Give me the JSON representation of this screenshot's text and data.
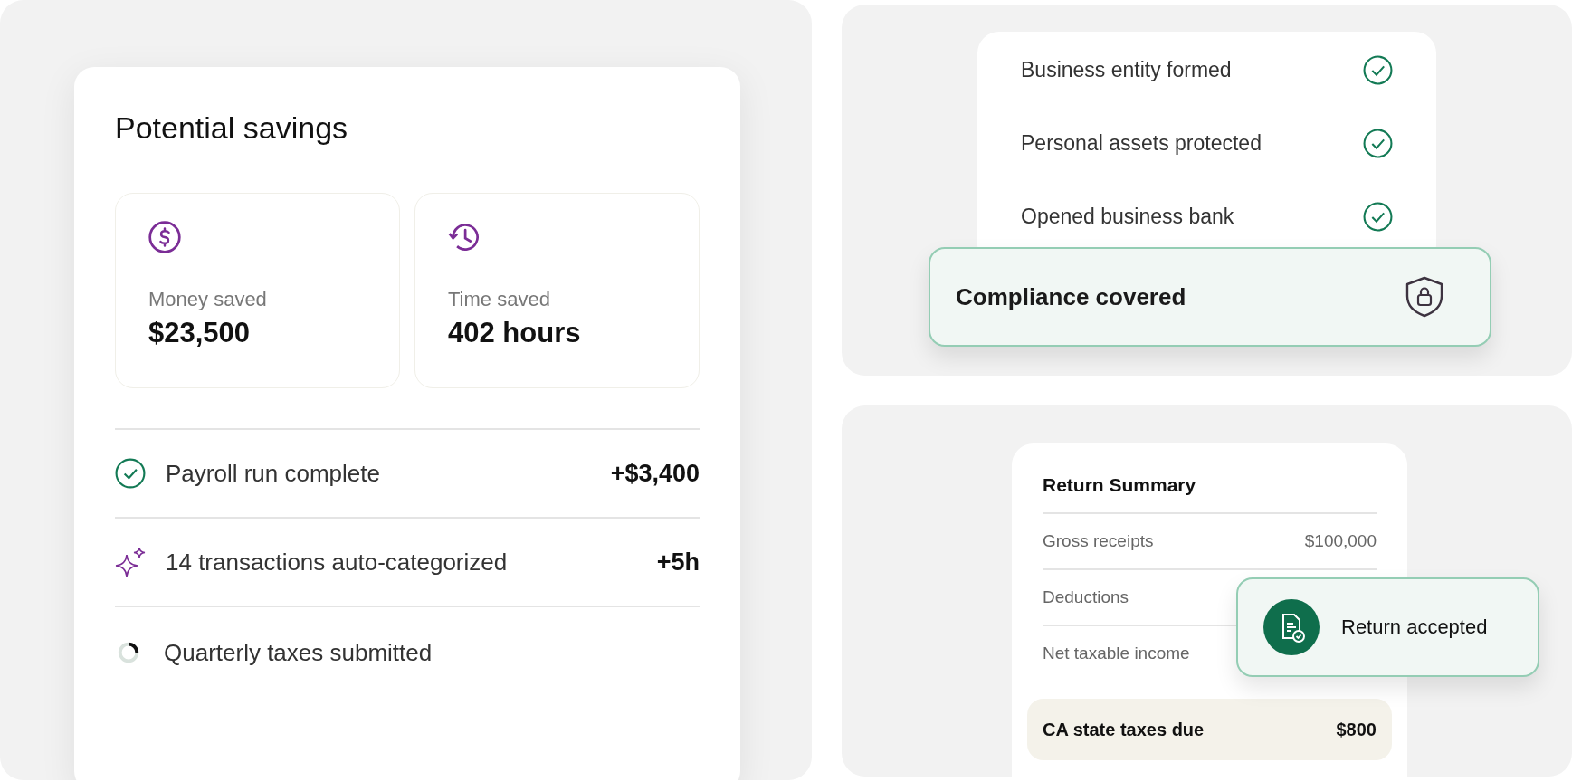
{
  "savings": {
    "title": "Potential savings",
    "stats": [
      {
        "kind": "money",
        "label": "Money saved",
        "value": "$23,500"
      },
      {
        "kind": "time",
        "label": "Time saved",
        "value": "402 hours"
      }
    ],
    "activity": [
      {
        "kind": "done",
        "text": "Payroll run complete",
        "amount": "+$3,400"
      },
      {
        "kind": "sparkle",
        "text": "14 transactions auto-categorized",
        "amount": "+5h"
      },
      {
        "kind": "pending",
        "text": "Quarterly taxes submitted"
      }
    ]
  },
  "checklist": {
    "items": [
      {
        "text": "Business entity formed",
        "checked": true
      },
      {
        "text": "Personal assets protected",
        "checked": true
      },
      {
        "text": "Opened business bank",
        "checked": true
      }
    ],
    "banner": "Compliance covered"
  },
  "return_summary": {
    "title": "Return Summary",
    "rows": [
      {
        "label": "Gross receipts",
        "value": "$100,000"
      },
      {
        "label": "Deductions"
      },
      {
        "label": "Net taxable income"
      }
    ],
    "total": {
      "label": "CA state taxes due",
      "value": "$800"
    },
    "toast": "Return accepted"
  }
}
